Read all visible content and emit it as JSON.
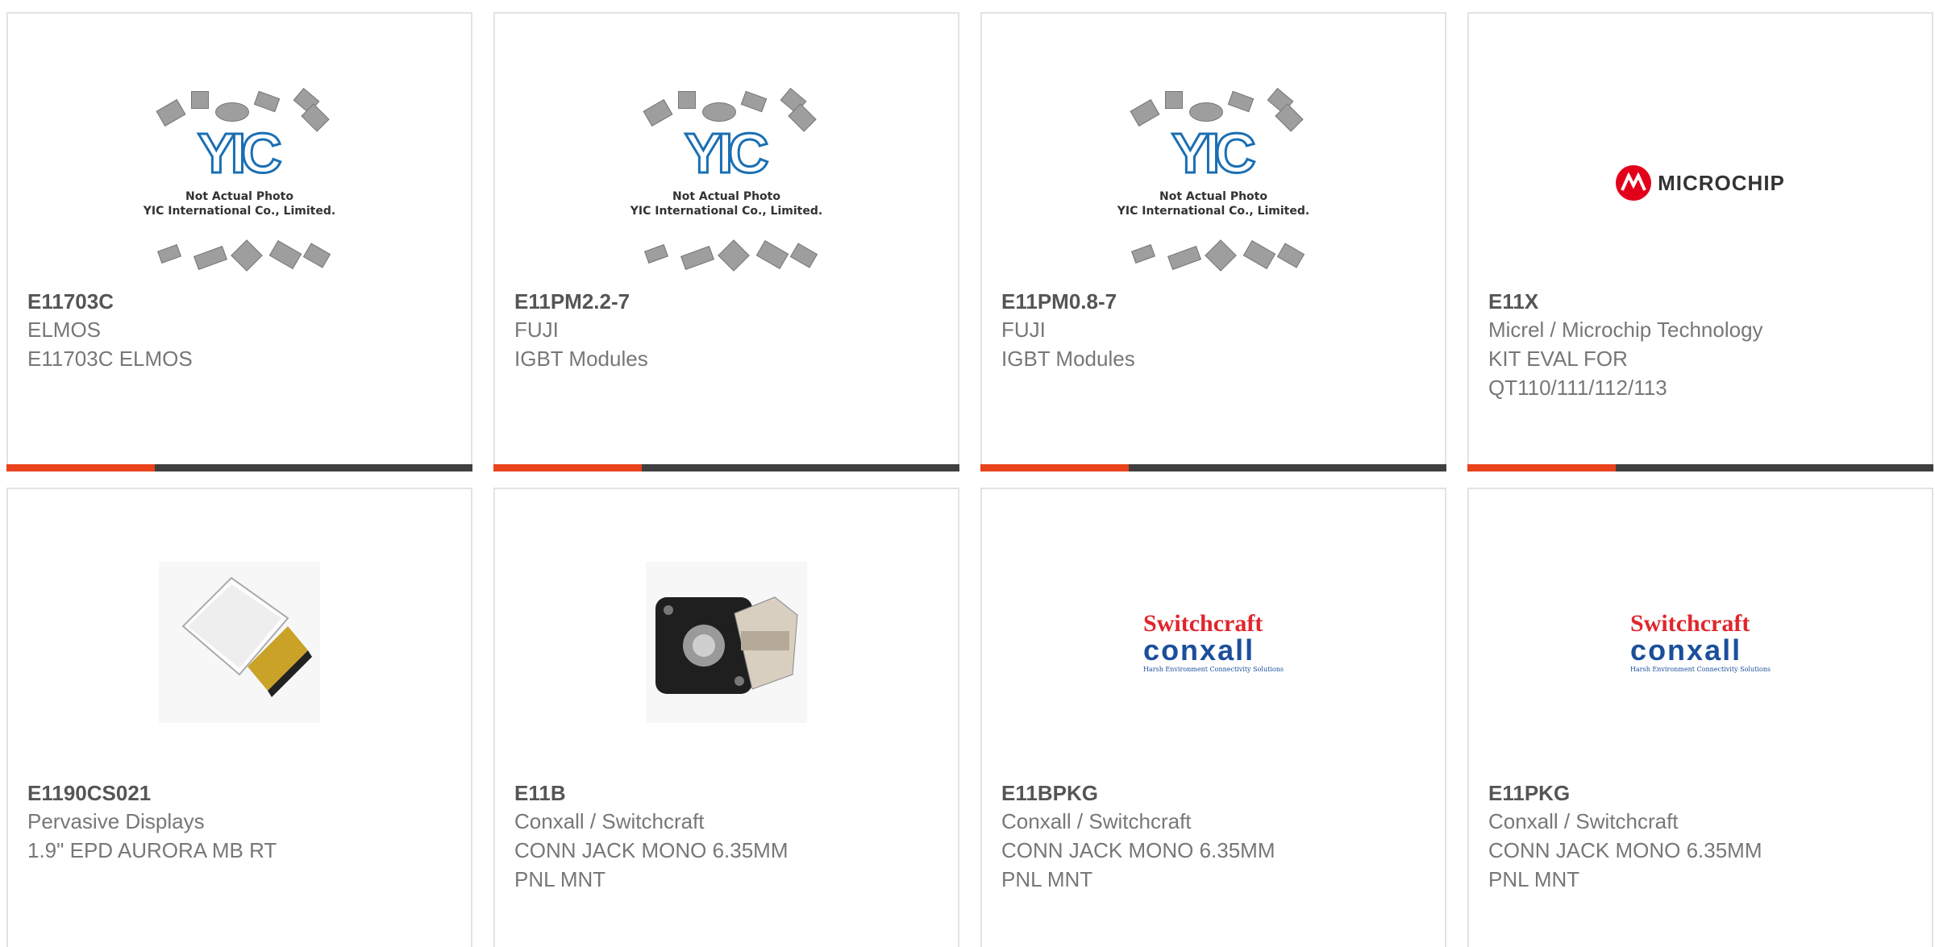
{
  "products": [
    {
      "part": "E11703C",
      "brand": "ELMOS",
      "desc": [
        "E11703C ELMOS"
      ],
      "image": "yic-placeholder"
    },
    {
      "part": "E11PM2.2-7",
      "brand": "FUJI",
      "desc": [
        "IGBT Modules"
      ],
      "image": "yic-placeholder"
    },
    {
      "part": "E11PM0.8-7",
      "brand": "FUJI",
      "desc": [
        "IGBT Modules"
      ],
      "image": "yic-placeholder"
    },
    {
      "part": "E11X",
      "brand": "Micrel / Microchip Technology",
      "desc": [
        "KIT EVAL FOR",
        "QT110/111/112/113"
      ],
      "image": "microchip-logo"
    },
    {
      "part": "E1190CS021",
      "brand": "Pervasive Displays",
      "desc": [
        "1.9\" EPD AURORA MB RT"
      ],
      "image": "epd-display-photo"
    },
    {
      "part": "E11B",
      "brand": "Conxall / Switchcraft",
      "desc": [
        "CONN JACK MONO 6.35MM",
        "PNL MNT"
      ],
      "image": "jack-photo"
    },
    {
      "part": "E11BPKG",
      "brand": "Conxall / Switchcraft",
      "desc": [
        "CONN JACK MONO 6.35MM",
        "PNL MNT"
      ],
      "image": "switchcraft-logo"
    },
    {
      "part": "E11PKG",
      "brand": "Conxall / Switchcraft",
      "desc": [
        "CONN JACK MONO 6.35MM",
        "PNL MNT"
      ],
      "image": "switchcraft-logo"
    }
  ],
  "placeholder": {
    "logo": "YIC",
    "line1": "Not Actual Photo",
    "line2": "YIC International Co., Limited."
  },
  "microchip": {
    "word": "MICROCHIP"
  },
  "switchcraft": {
    "line1": "Switchcraft",
    "line2": "conxall",
    "line3": "Harsh Environment Connectivity Solutions"
  },
  "colors": {
    "accent": "#e8431c",
    "bar": "#3f3f3f",
    "border": "#e3e3e3"
  }
}
